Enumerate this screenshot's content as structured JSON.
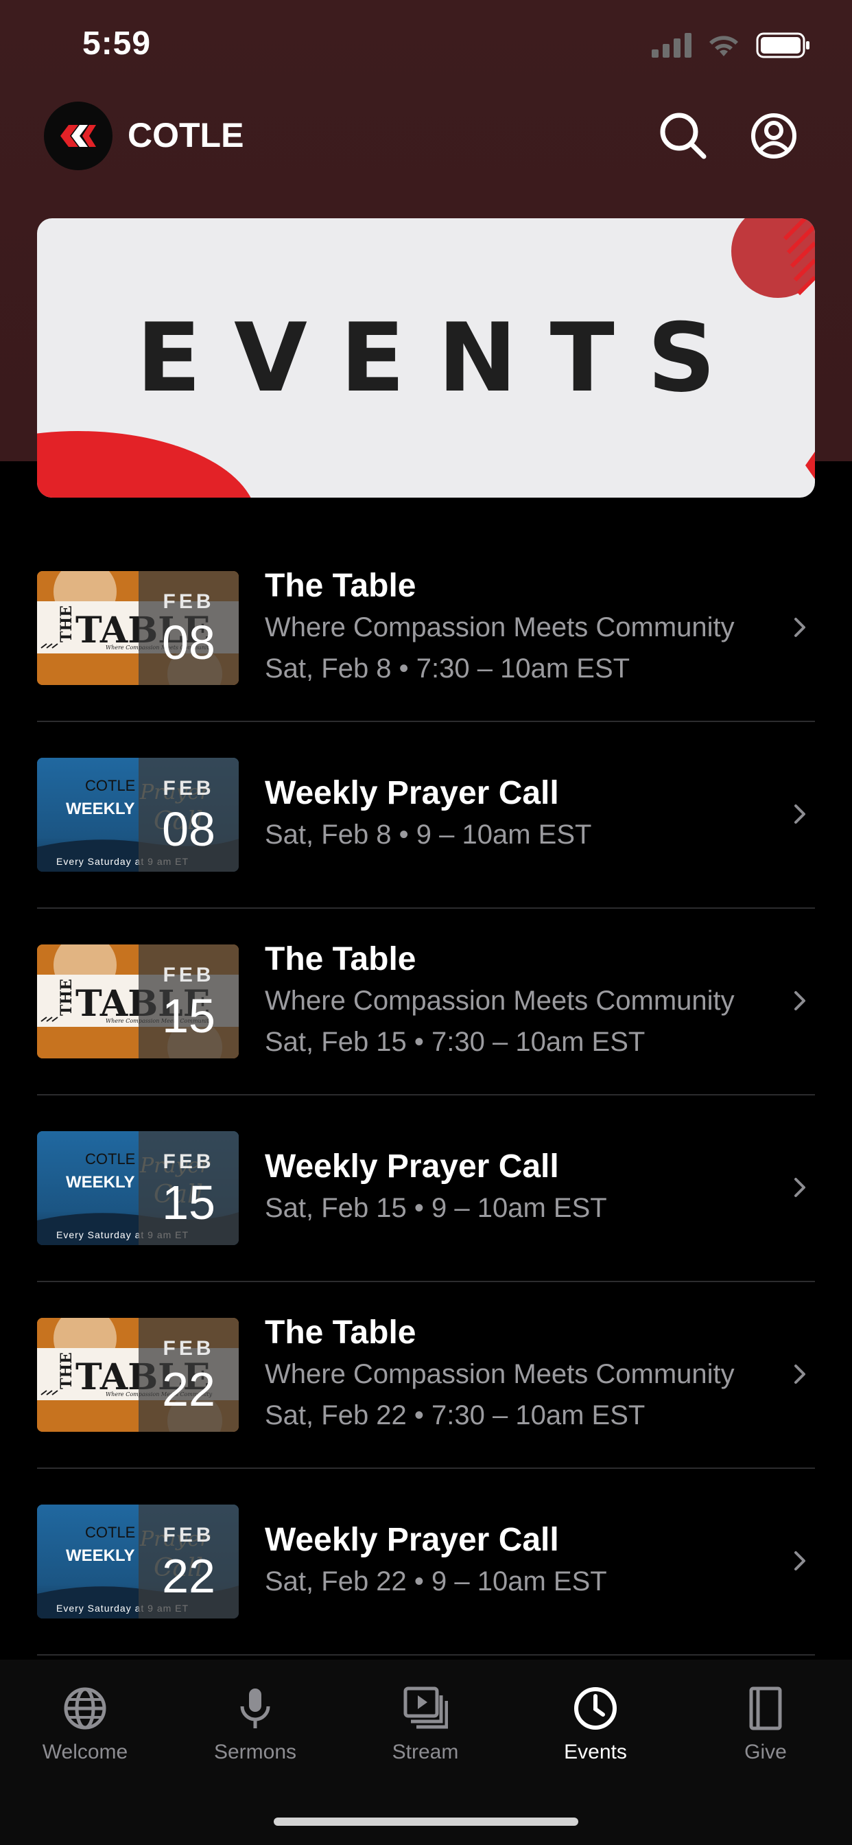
{
  "status": {
    "time": "5:59"
  },
  "header": {
    "title": "COTLE"
  },
  "banner": {
    "title": "EVENTS"
  },
  "events": [
    {
      "kind": "table",
      "month": "FEB",
      "day": "08",
      "title": "The Table",
      "subtitle": "Where Compassion Meets Community",
      "when": "Sat, Feb 8 • 7:30 – 10am EST"
    },
    {
      "kind": "prayer",
      "month": "FEB",
      "day": "08",
      "title": "Weekly Prayer Call",
      "subtitle": "",
      "when": "Sat, Feb 8 • 9 – 10am EST"
    },
    {
      "kind": "table",
      "month": "FEB",
      "day": "15",
      "title": "The Table",
      "subtitle": "Where Compassion Meets Community",
      "when": "Sat, Feb 15 • 7:30 – 10am EST"
    },
    {
      "kind": "prayer",
      "month": "FEB",
      "day": "15",
      "title": "Weekly Prayer Call",
      "subtitle": "",
      "when": "Sat, Feb 15 • 9 – 10am EST"
    },
    {
      "kind": "table",
      "month": "FEB",
      "day": "22",
      "title": "The Table",
      "subtitle": "Where Compassion Meets Community",
      "when": "Sat, Feb 22 • 7:30 – 10am EST"
    },
    {
      "kind": "prayer",
      "month": "FEB",
      "day": "22",
      "title": "Weekly Prayer Call",
      "subtitle": "",
      "when": "Sat, Feb 22 • 9 – 10am EST"
    }
  ],
  "thumb_text": {
    "table_word": "THE TABLE",
    "table_tagline": "Where Compassion Meets Community",
    "prayer_line1": "COTLE",
    "prayer_line2": "WEEKLY",
    "prayer_script": "Prayer Call",
    "prayer_footer": "Every Saturday at 9 am ET"
  },
  "tabs": [
    {
      "label": "Welcome",
      "icon": "globe-icon",
      "active": false
    },
    {
      "label": "Sermons",
      "icon": "microphone-icon",
      "active": false
    },
    {
      "label": "Stream",
      "icon": "play-stack-icon",
      "active": false
    },
    {
      "label": "Events",
      "icon": "clock-icon",
      "active": true
    },
    {
      "label": "Give",
      "icon": "book-icon",
      "active": false
    }
  ],
  "colors": {
    "header_bg": "#3d1c1e",
    "accent_red": "#e32227",
    "active_tab": "#ffffff",
    "inactive_tab": "#8d8d92"
  }
}
